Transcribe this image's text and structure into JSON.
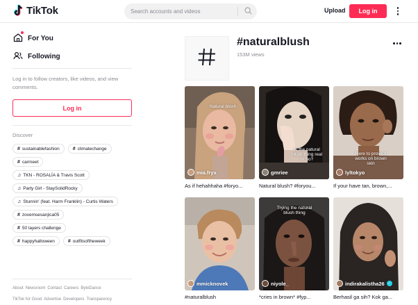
{
  "header": {
    "logo_text": "TikTok",
    "search_placeholder": "Search accounts and videos",
    "upload_label": "Upload",
    "login_label": "Log in"
  },
  "sidebar": {
    "nav": [
      {
        "label": "For You",
        "icon": "home-icon"
      },
      {
        "label": "Following",
        "icon": "users-icon"
      }
    ],
    "login_prompt": "Log in to follow creators, like videos, and view comments.",
    "login_label": "Log in",
    "discover_title": "Discover",
    "discover_tags": [
      {
        "label": "sustainablefashion",
        "icon": "hashtag-icon"
      },
      {
        "label": "climatechange",
        "icon": "hashtag-icon"
      },
      {
        "label": "carmeet",
        "icon": "hashtag-icon"
      },
      {
        "label": "TKN - ROSALÍA & Travis Scott",
        "icon": "music-note-icon"
      },
      {
        "label": "Party Girl - StaySolidRocky",
        "icon": "music-note-icon"
      },
      {
        "label": "Stunnin' (feat. Harm Franklin) - Curtis Waters",
        "icon": "music-note-icon"
      },
      {
        "label": "zovemsesanjica05",
        "icon": "hashtag-icon"
      },
      {
        "label": "50 layers challenge",
        "icon": "hashtag-icon"
      },
      {
        "label": "happyhalloween",
        "icon": "hashtag-icon"
      },
      {
        "label": "outfitsoftheweek",
        "icon": "hashtag-icon"
      }
    ],
    "footer_row1": [
      "About",
      "Newsroom",
      "Contact",
      "Careers",
      "ByteDance"
    ],
    "footer_row2": [
      "TikTok for Good",
      "Advertise",
      "Developers",
      "Transparency"
    ]
  },
  "tag_page": {
    "title": "#naturalblush",
    "views": "153M views"
  },
  "videos": [
    {
      "author": "mia.fryx",
      "caption": "As if hehahhaha #foryo...",
      "overlay": "Natural blush",
      "verified": false
    },
    {
      "author": "gmriee",
      "caption": "Natural blush? #foryou...",
      "overlay": "Is the natural blush thing real or no?",
      "verified": false
    },
    {
      "author": "lyltokyo",
      "caption": "If your have tan, brown,...",
      "overlay": "Here to prove it works on brown skin",
      "verified": false
    },
    {
      "author": "mmicknovek",
      "caption": "#naturalblush",
      "overlay": "",
      "verified": false
    },
    {
      "author": "niyole_",
      "caption": "*cries in brown* #fyp...",
      "overlay": "Trying the natural blush thing",
      "verified": false
    },
    {
      "author": "indirakalistha26",
      "caption": "Berhasil ga sih? Kok ga...",
      "overlay": "",
      "verified": true
    }
  ],
  "colors": {
    "brand": "#fe2c55",
    "text": "#161823",
    "muted": "#8a8b91",
    "verified": "#20d5ec"
  }
}
